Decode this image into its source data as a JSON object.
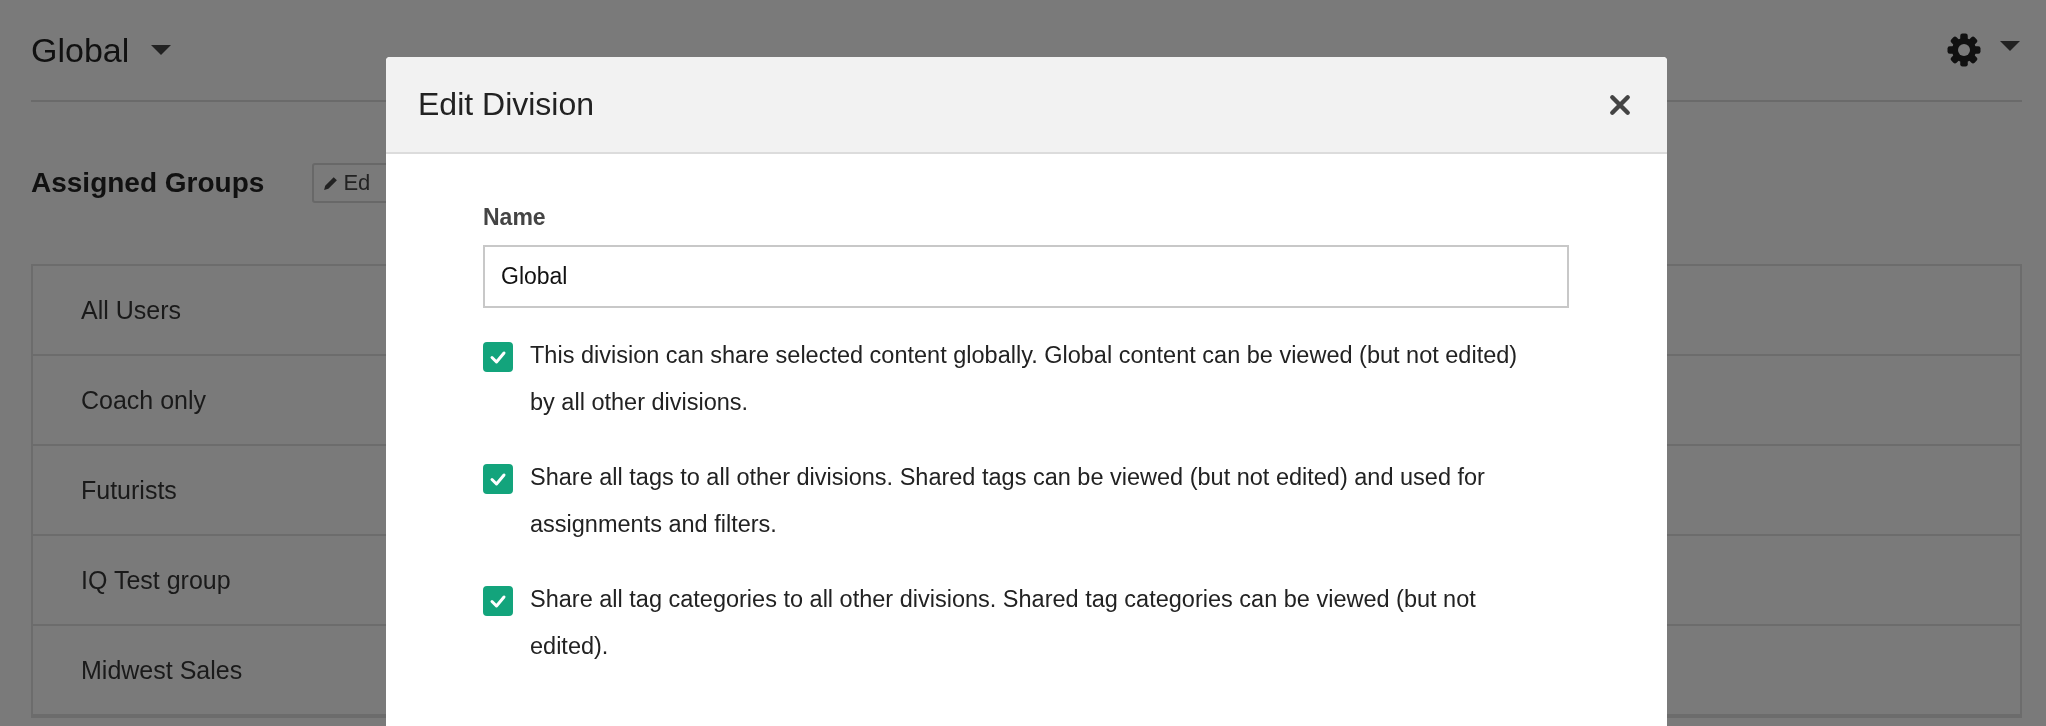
{
  "page": {
    "title": "Global",
    "section_title": "Assigned Groups",
    "edit_button": "Ed"
  },
  "groups": [
    "All Users",
    "Coach only",
    "Futurists",
    "IQ Test group",
    "Midwest Sales"
  ],
  "modal": {
    "title": "Edit Division",
    "name_label": "Name",
    "name_value": "Global",
    "options": [
      {
        "label": "This division can share selected content globally. Global content can be viewed (but not edited) by all other divisions.",
        "checked": true
      },
      {
        "label": "Share all tags to all other divisions. Shared tags can be viewed (but not edited) and used for assignments and filters.",
        "checked": true
      },
      {
        "label": "Share all tag categories to all other divisions. Shared tag categories can be viewed (but not edited).",
        "checked": true
      }
    ]
  }
}
